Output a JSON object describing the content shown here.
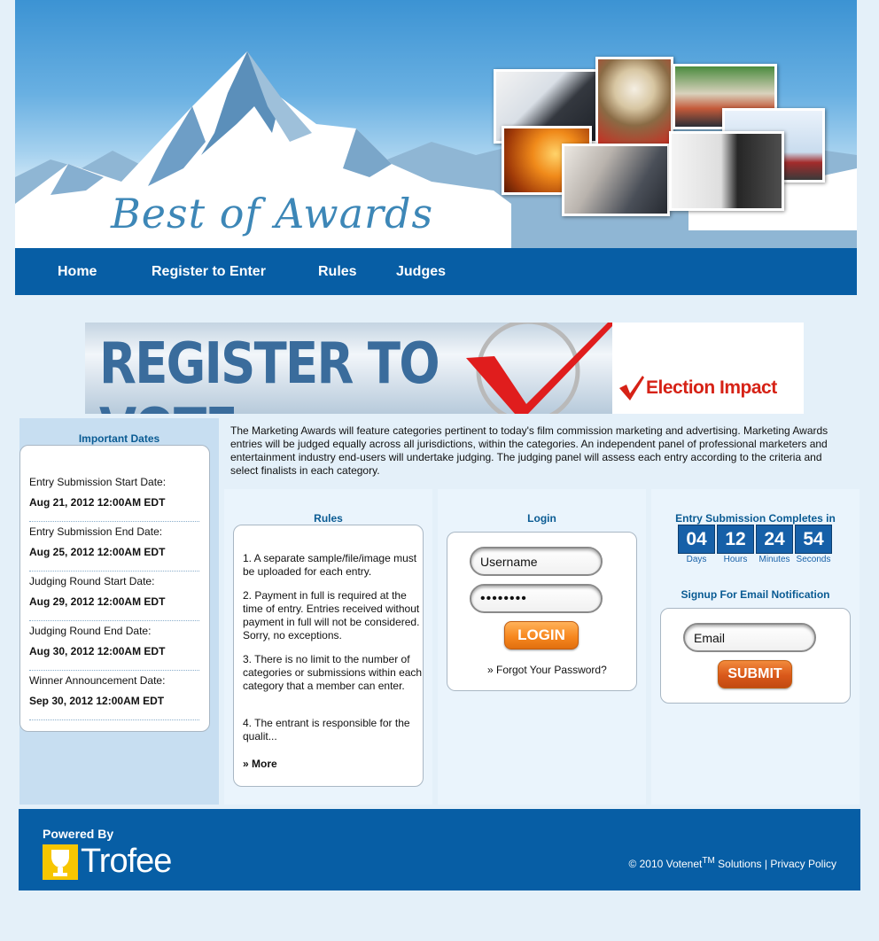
{
  "header": {
    "logo_text": "Best of Awards"
  },
  "nav": {
    "items": [
      {
        "label": "Home"
      },
      {
        "label": "Register to Enter"
      },
      {
        "label": "Rules"
      },
      {
        "label": "Judges"
      }
    ]
  },
  "banner": {
    "headline": "REGISTER TO VOTE",
    "brand": "Election Impact"
  },
  "important_dates": {
    "title": "Important Dates",
    "entries": [
      {
        "label": "Entry Submission Start Date:",
        "value": "Aug 21, 2012 12:00AM EDT"
      },
      {
        "label": "Entry Submission End Date:",
        "value": "Aug 25, 2012 12:00AM EDT"
      },
      {
        "label": "Judging Round Start Date:",
        "value": "Aug 29, 2012 12:00AM EDT"
      },
      {
        "label": "Judging Round End Date:",
        "value": "Aug 30, 2012 12:00AM EDT"
      },
      {
        "label": "Winner Announcement Date:",
        "value": "Sep 30, 2012 12:00AM EDT"
      }
    ]
  },
  "description": "The Marketing Awards will feature categories pertinent to today's film commission marketing and advertising. Marketing Awards entries will be judged equally across all jurisdictions, within the categories. An independent panel of professional marketers and entertainment industry end-users will undertake judging. The judging panel will assess each entry according to the criteria and select finalists in each category.",
  "rules": {
    "title": "Rules",
    "items": [
      "1. A separate sample/file/image must be uploaded for each entry.",
      "2. Payment in full is required at the time of entry. Entries received without payment in full will not be considered. Sorry, no exceptions.",
      "3. There is no limit to the number of categories or submissions within each category that a member can enter.",
      "4. The entrant is responsible for the qualit..."
    ],
    "more_label": "» More"
  },
  "login": {
    "title": "Login",
    "username_value": "Username",
    "password_value": "••••••••",
    "button_label": "LOGIN",
    "forgot_label": "» Forgot Your Password?"
  },
  "countdown": {
    "title": "Entry Submission Completes in",
    "units": [
      {
        "value": "04",
        "label": "Days"
      },
      {
        "value": "12",
        "label": "Hours"
      },
      {
        "value": "24",
        "label": "Minutes"
      },
      {
        "value": "54",
        "label": "Seconds"
      }
    ]
  },
  "signup": {
    "title": "Signup For Email Notification",
    "email_value": "Email",
    "button_label": "SUBMIT"
  },
  "footer": {
    "powered_by": "Powered By",
    "brand": "Trofee",
    "copyright_prefix": "© 2010 Votenet",
    "copyright_tm": "TM",
    "copyright_suffix": " Solutions | ",
    "privacy_label": "Privacy Policy"
  }
}
